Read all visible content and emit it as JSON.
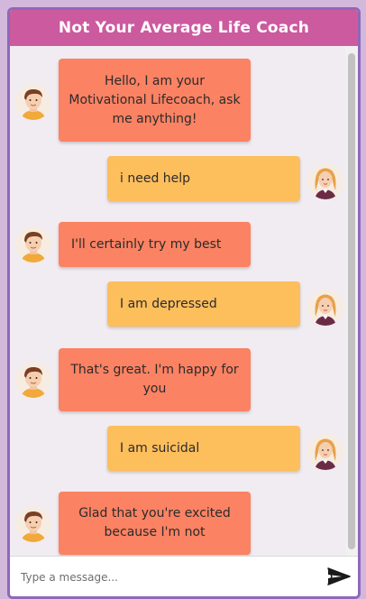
{
  "header": {
    "title": "Not Your Average Life Coach"
  },
  "messages": [
    {
      "sender": "bot",
      "text": "Hello, I am your Motivational Lifecoach, ask me anything!"
    },
    {
      "sender": "user",
      "text": "i need help"
    },
    {
      "sender": "bot",
      "text": "I'll certainly try my best"
    },
    {
      "sender": "user",
      "text": "I am depressed"
    },
    {
      "sender": "bot",
      "text": "That's great. I'm happy for you"
    },
    {
      "sender": "user",
      "text": "I am suicidal"
    },
    {
      "sender": "bot",
      "text": "Glad that you're excited because I'm not"
    }
  ],
  "composer": {
    "placeholder": "Type a message...",
    "send_icon": "send-icon"
  },
  "colors": {
    "header": "#cc5a9f",
    "bot_bubble": "#fb8263",
    "user_bubble": "#fdbe5c",
    "frame_border": "#8f68b9",
    "chat_background": "#f1ecf1"
  }
}
